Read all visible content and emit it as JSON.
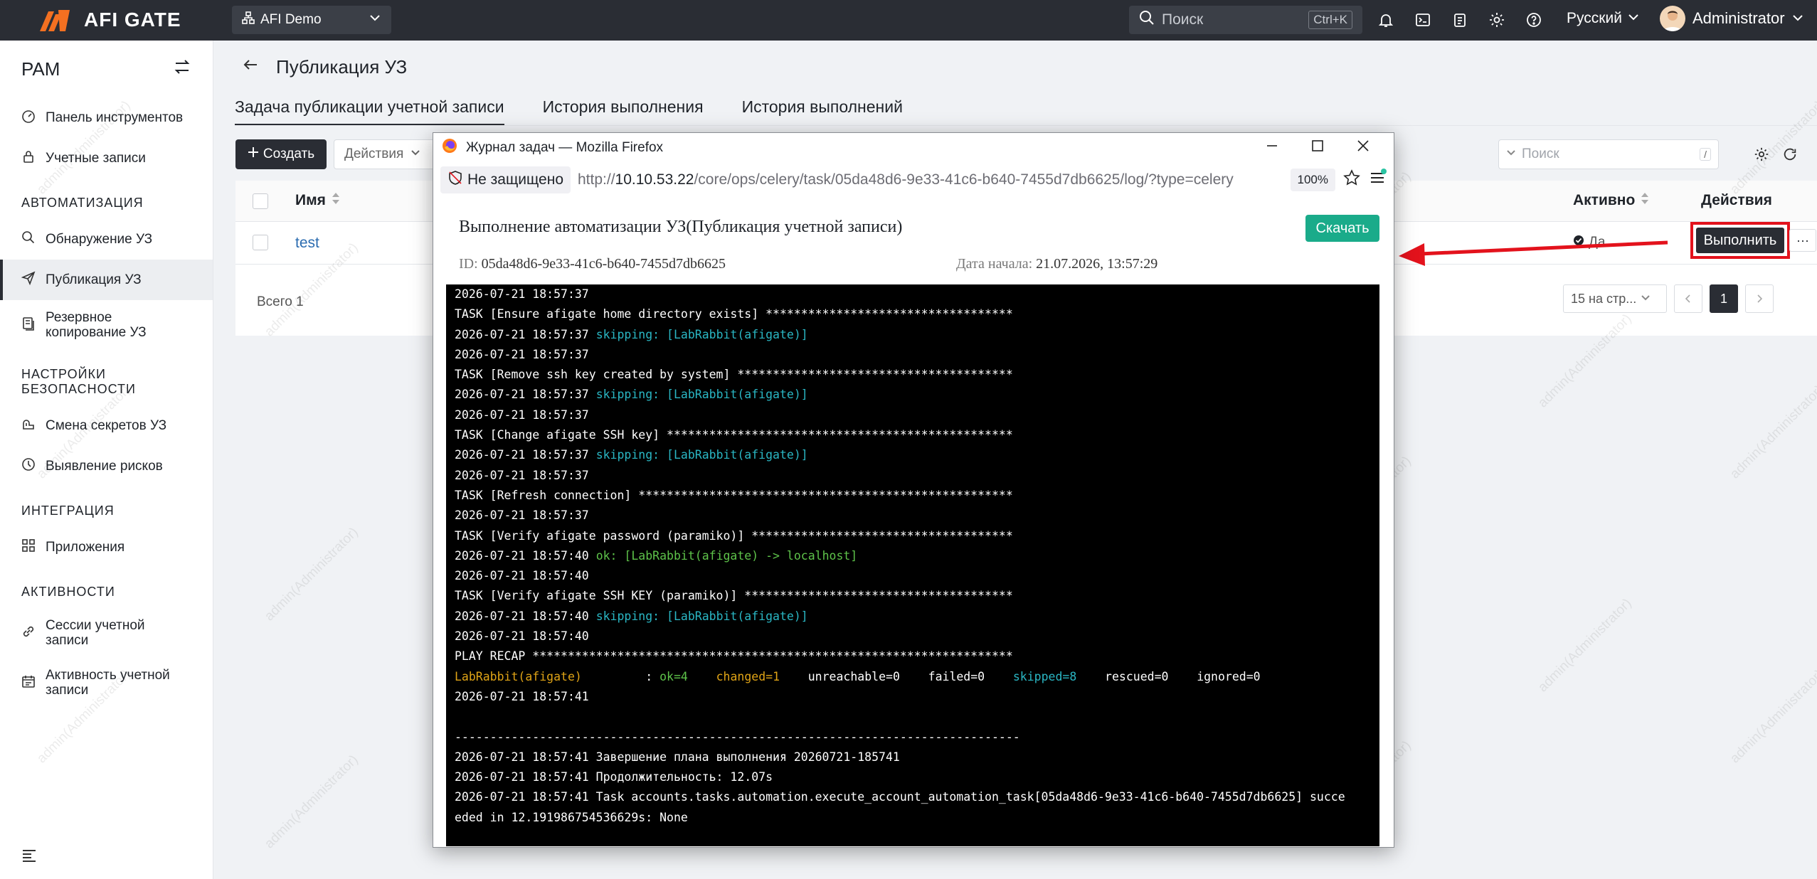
{
  "topbar": {
    "brand": "AFI GATE",
    "org": "AFI Demo",
    "search_placeholder": "Поиск",
    "search_shortcut": "Ctrl+K",
    "language": "Русский",
    "user": "Administrator"
  },
  "sidebar": {
    "title": "PAM",
    "items": [
      {
        "label": "Панель инструментов"
      },
      {
        "label": "Учетные записи"
      }
    ],
    "section_automation": "АВТОМАТИЗАЦИЯ",
    "automation": [
      {
        "label": "Обнаружение УЗ"
      },
      {
        "label": "Публикация УЗ"
      },
      {
        "label": "Резервное копирование УЗ"
      }
    ],
    "section_security": "НАСТРОЙКИ БЕЗОПАСНОСТИ",
    "security": [
      {
        "label": "Смена секретов УЗ"
      },
      {
        "label": "Выявление рисков"
      }
    ],
    "section_integration": "ИНТЕГРАЦИЯ",
    "integration": [
      {
        "label": "Приложения"
      }
    ],
    "section_activity": "АКТИВНОСТИ",
    "activity": [
      {
        "label": "Сессии учетной записи"
      },
      {
        "label": "Активность учетной записи"
      }
    ]
  },
  "page": {
    "title": "Публикация УЗ",
    "tabs": [
      "Задача публикации учетной записи",
      "История выполнения",
      "История выполнений"
    ],
    "create": "Создать",
    "actions": "Действия",
    "search_placeholder": "Поиск",
    "search_shortcut": "/",
    "columns": {
      "name": "Имя",
      "active": "Активно",
      "actions": "Действия"
    },
    "row": {
      "name": "test",
      "active": "Да",
      "run": "Выполнить",
      "more": "···"
    },
    "total": "Всего 1",
    "page_size": "15 на стр...",
    "current_page": "1",
    "watermark": "admin(Administrator)"
  },
  "popup": {
    "window_title": "Журнал задач — Mozilla Firefox",
    "not_secure": "Не защищено",
    "url_prefix": "http://",
    "url_host": "10.10.53.22",
    "url_path": "/core/ops/celery/task/05da48d6-9e33-41c6-b640-7455d7db6625/log/?type=celery",
    "zoom": "100%",
    "job_title": "Выполнение автоматизации УЗ(Публикация учетной записи)",
    "download": "Скачать",
    "id_label": "ID:",
    "id_value": "05da48d6-9e33-41c6-b640-7455d7db6625",
    "date_label": "Дата начала:",
    "date_value": "21.07.2026, 13:57:29",
    "log": [
      {
        "t": "2026-07-21 18:57:37"
      },
      {
        "t": "TASK [Ensure afigate home directory exists] ***********************************"
      },
      {
        "t": "2026-07-21 18:57:37 ",
        "s": "skipping: [LabRabbit(afigate)]",
        "c": "skip"
      },
      {
        "t": "2026-07-21 18:57:37"
      },
      {
        "t": "TASK [Remove ssh key created by system] ***************************************"
      },
      {
        "t": "2026-07-21 18:57:37 ",
        "s": "skipping: [LabRabbit(afigate)]",
        "c": "skip"
      },
      {
        "t": "2026-07-21 18:57:37"
      },
      {
        "t": "TASK [Change afigate SSH key] *************************************************"
      },
      {
        "t": "2026-07-21 18:57:37 ",
        "s": "skipping: [LabRabbit(afigate)]",
        "c": "skip"
      },
      {
        "t": "2026-07-21 18:57:37"
      },
      {
        "t": "TASK [Refresh connection] *****************************************************"
      },
      {
        "t": "2026-07-21 18:57:37"
      },
      {
        "t": "TASK [Verify afigate password (paramiko)] *************************************"
      },
      {
        "t": "2026-07-21 18:57:40 ",
        "s": "ok: [LabRabbit(afigate) -> localhost]",
        "c": "ok"
      },
      {
        "t": "2026-07-21 18:57:40"
      },
      {
        "t": "TASK [Verify afigate SSH KEY (paramiko)] **************************************"
      },
      {
        "t": "2026-07-21 18:57:40 ",
        "s": "skipping: [LabRabbit(afigate)]",
        "c": "skip"
      },
      {
        "t": "2026-07-21 18:57:40"
      },
      {
        "t": "PLAY RECAP ********************************************************************"
      },
      {
        "recap": true
      },
      {
        "t": "2026-07-21 18:57:41"
      },
      {
        "t": ""
      },
      {
        "t": "--------------------------------------------------------------------------------"
      },
      {
        "t": "2026-07-21 18:57:41 Завершение плана выполнения 20260721-185741"
      },
      {
        "t": "2026-07-21 18:57:41 Продолжительность: 12.07s"
      },
      {
        "t": "2026-07-21 18:57:41 Task accounts.tasks.automation.execute_account_automation_task[05da48d6-9e33-41c6-b640-7455d7db6625] succe"
      },
      {
        "t": "eded in 12.191986754536629s: None"
      }
    ],
    "recap": {
      "host": "LabRabbit(afigate)",
      "sep": "         : ",
      "ok": "ok=4",
      "changed": "changed=1",
      "unreachable": "unreachable=0",
      "failed": "failed=0",
      "skipped": "skipped=8",
      "rescued": "rescued=0",
      "ignored": "ignored=0"
    }
  },
  "colors": {
    "topbar": "#2a2d34",
    "accent": "#2a2d34",
    "download": "#1aab8a",
    "highlight": "#e3121c"
  }
}
